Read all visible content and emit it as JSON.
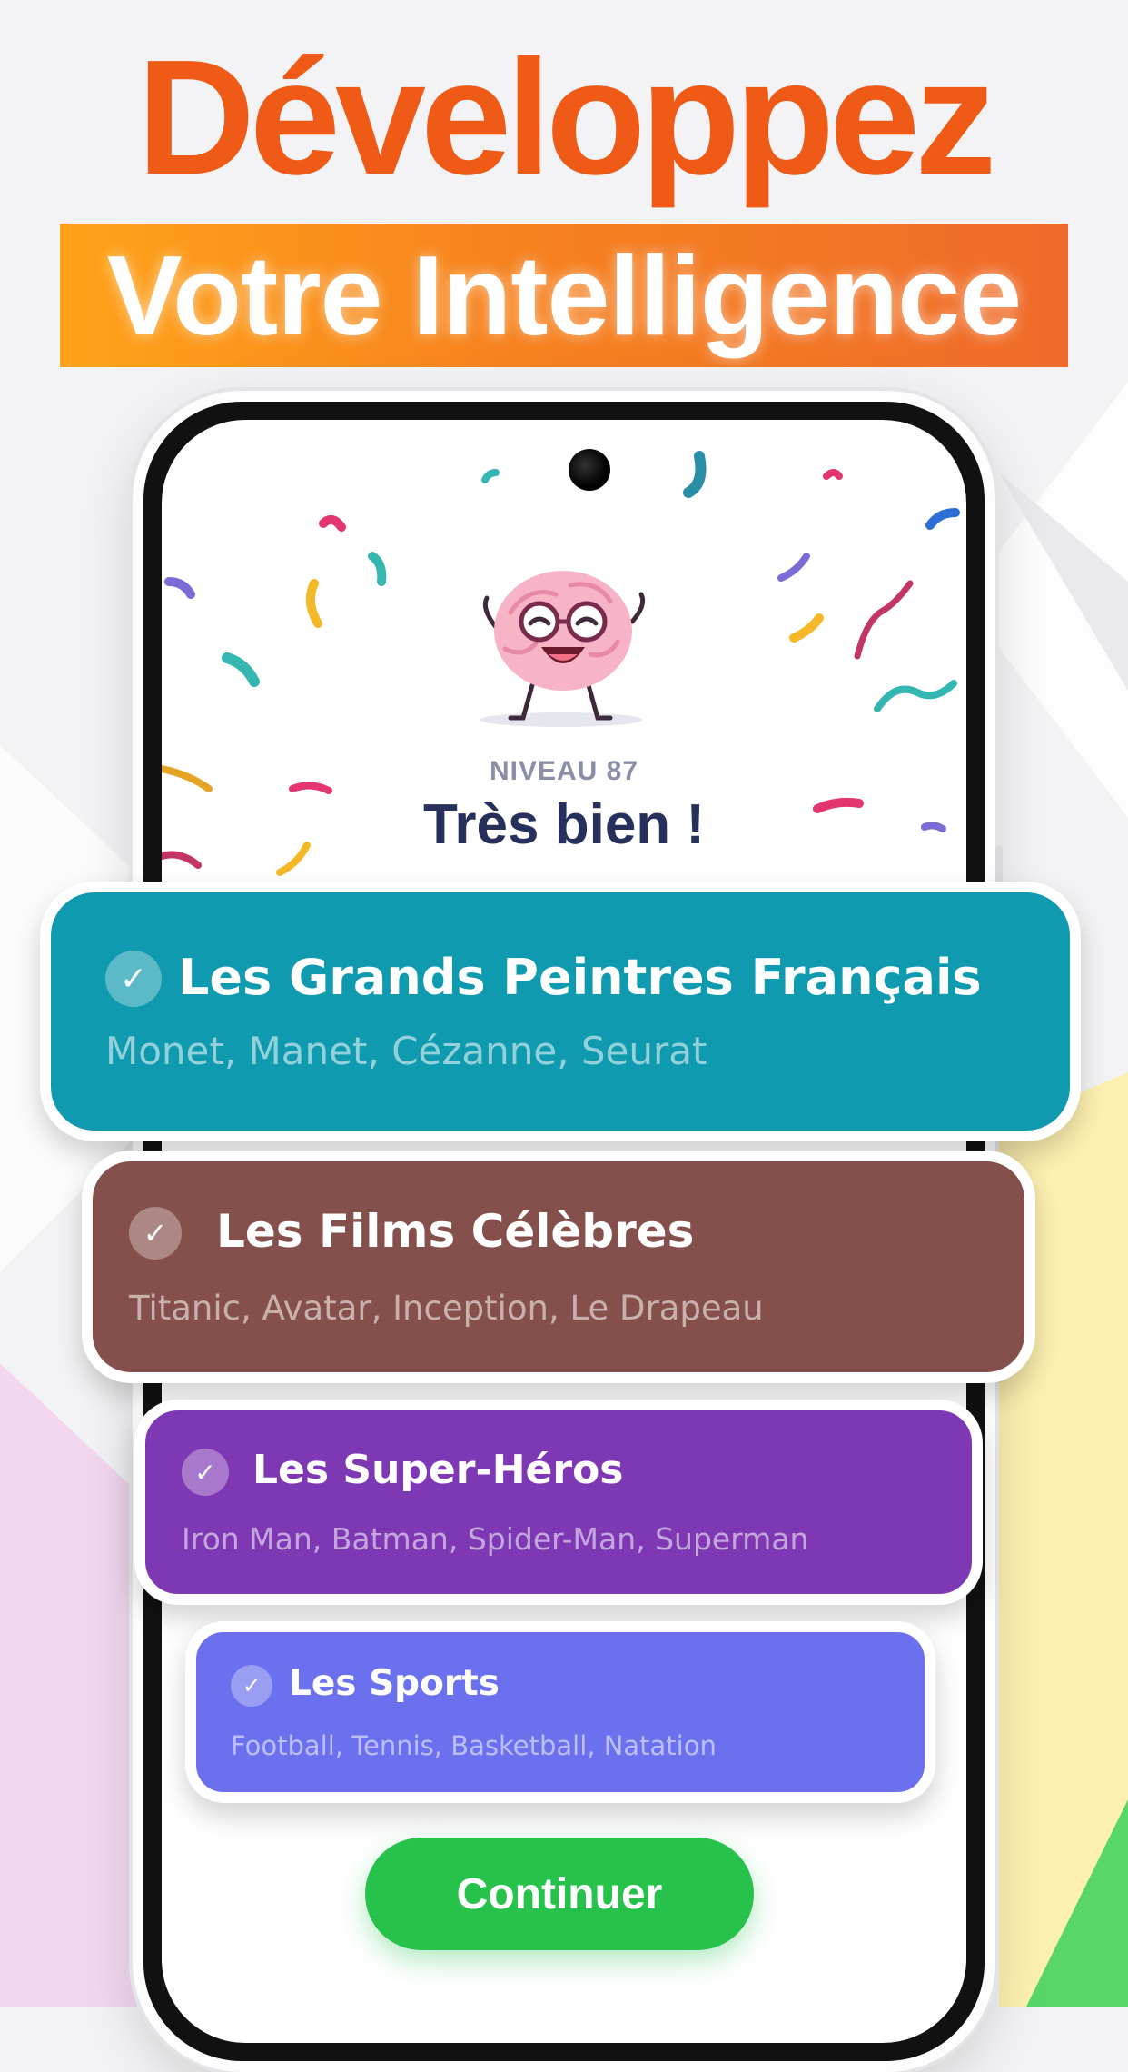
{
  "headline": {
    "line1": "Développez",
    "line2": "Votre Intelligence"
  },
  "result": {
    "level_label": "NIVEAU 87",
    "title": "Très bien !"
  },
  "categories": [
    {
      "title": "Les Grands Peintres Français",
      "subtitle": "Monet, Manet, Cézanne, Seurat",
      "color": "#0f9aaf",
      "completed": true
    },
    {
      "title": "Les Films Célèbres",
      "subtitle": "Titanic, Avatar, Inception, Le Drapeau",
      "color": "#85504b",
      "completed": true
    },
    {
      "title": "Les Super-Héros",
      "subtitle": "Iron Man, Batman, Spider-Man, Superman",
      "color": "#7e38b4",
      "completed": true
    },
    {
      "title": "Les Sports",
      "subtitle": "Football, Tennis, Basketball, Natation",
      "color": "#6a70ee",
      "completed": true
    }
  ],
  "continue_button": {
    "label": "Continuer"
  },
  "colors": {
    "accent_orange": "#f05a17",
    "button_green": "#27c24c",
    "title_navy": "#27305a"
  },
  "icons": {
    "check": "check-circle-icon",
    "camera": "camera-icon"
  }
}
